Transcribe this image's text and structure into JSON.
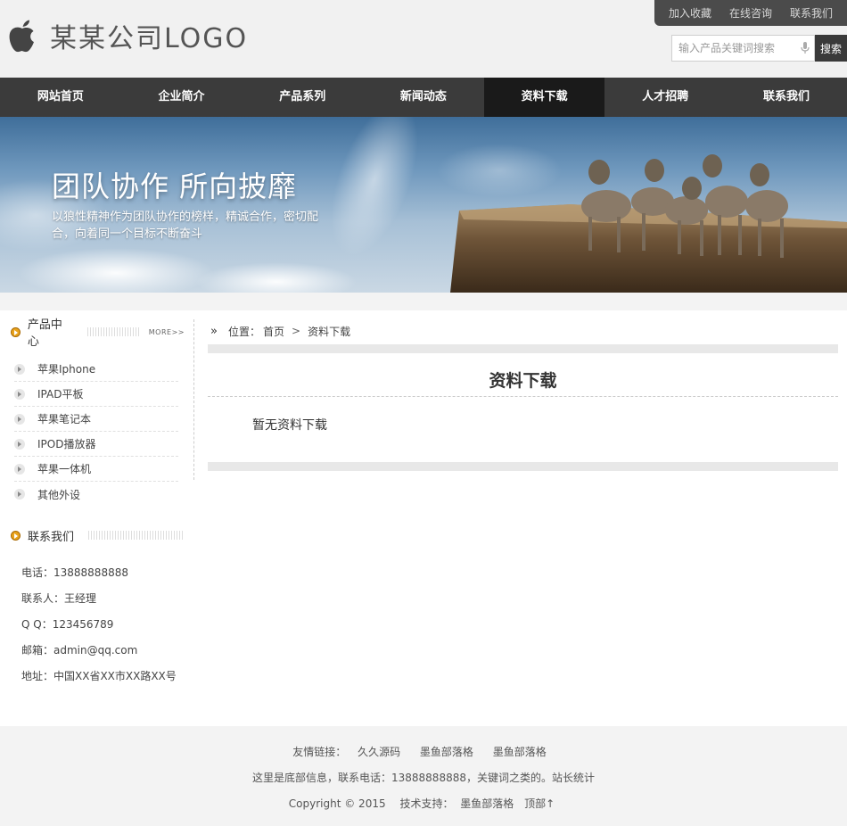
{
  "header": {
    "logo_text": "某某公司LOGO",
    "top_links": [
      "加入收藏",
      "在线咨询",
      "联系我们"
    ],
    "search_placeholder": "输入产品关键词搜索",
    "search_button": "搜索"
  },
  "nav": {
    "items": [
      "网站首页",
      "企业简介",
      "产品系列",
      "新闻动态",
      "资料下载",
      "人才招聘",
      "联系我们"
    ],
    "active_index": 4
  },
  "banner": {
    "title": "团队协作 所向披靡",
    "subtitle": "以狼性精神作为团队协作的榜样，精诚合作，密切配合，向着同一个目标不断奋斗"
  },
  "sidebar": {
    "product_title": "产品中心",
    "more_label": "MORE>>",
    "products": [
      "苹果Iphone",
      "IPAD平板",
      "苹果笔记本",
      "IPOD播放器",
      "苹果一体机",
      "其他外设"
    ],
    "contact_title": "联系我们",
    "contact": [
      "电话：13888888888",
      "联系人：王经理",
      "Q Q：123456789",
      "邮箱：admin@qq.com",
      "地址：中国XX省XX市XX路XX号"
    ]
  },
  "main": {
    "breadcrumb_label": "位置：",
    "breadcrumb_home": "首页",
    "breadcrumb_sep": ">",
    "breadcrumb_current": "资料下载",
    "title": "资料下载",
    "empty_message": "暂无资料下载"
  },
  "footer": {
    "links_label": "友情链接：",
    "links": [
      "久久源码",
      "墨鱼部落格",
      "墨鱼部落格"
    ],
    "info": "这里是底部信息，联系电话：13888888888，关键词之类的。站长统计",
    "copyright": "Copyright © 2015",
    "support_label": "技术支持：",
    "support_name": "墨鱼部落格",
    "top_link": "顶部↑"
  },
  "colors": {
    "nav_bg": "#3b3b3b",
    "nav_active": "#1a1a1a",
    "accent": "#e8a21c"
  }
}
